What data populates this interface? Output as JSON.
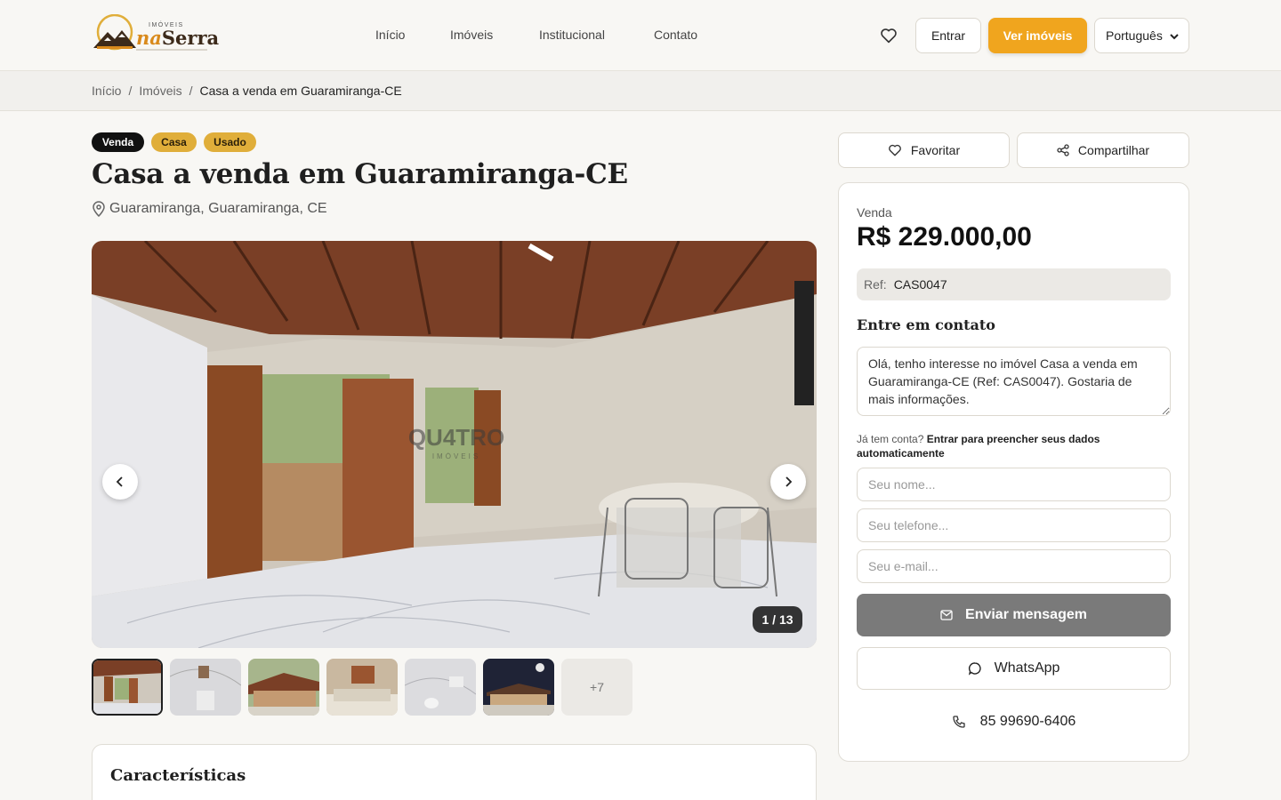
{
  "header": {
    "logo_small": "IMÓVEIS",
    "logo_pre": "na",
    "logo_main": "Serra",
    "nav": [
      "Início",
      "Imóveis",
      "Institucional",
      "Contato"
    ],
    "login_label": "Entrar",
    "cta_label": "Ver imóveis",
    "language": "Português"
  },
  "breadcrumb": {
    "items": [
      "Início",
      "Imóveis"
    ],
    "separator": "/",
    "current": "Casa a venda em Guaramiranga-CE"
  },
  "listing": {
    "badges": [
      "Venda",
      "Casa",
      "Usado"
    ],
    "title": "Casa a venda em Guaramiranga-CE",
    "location": "Guaramiranga, Guaramiranga, CE",
    "gallery_counter": "1 / 13",
    "watermark": "QU4TRO",
    "watermark_sub": "IMÓVEIS",
    "more_photos": "+7",
    "features_heading": "Características"
  },
  "sidebar": {
    "favorite_label": "Favoritar",
    "share_label": "Compartilhar",
    "price_label": "Venda",
    "price": "R$ 229.000,00",
    "ref_label": "Ref:",
    "ref_value": "CAS0047",
    "contact_heading": "Entre em contato",
    "message": "Olá, tenho interesse no imóvel Casa a venda em Guaramiranga-CE (Ref: CAS0047). Gostaria de mais informações.",
    "account_prompt": "Já tem conta?",
    "account_link": "Entrar para preencher seus dados automaticamente",
    "name_placeholder": "Seu nome...",
    "phone_placeholder": "Seu telefone...",
    "email_placeholder": "Seu e-mail...",
    "send_label": "Enviar mensagem",
    "whatsapp_label": "WhatsApp",
    "phone_number": "85 99690-6406"
  },
  "colors": {
    "accent": "#f0a51e",
    "badge_dark": "#111111",
    "badge_gold": "#e0ae3a",
    "send_button": "#7a7a7a"
  }
}
